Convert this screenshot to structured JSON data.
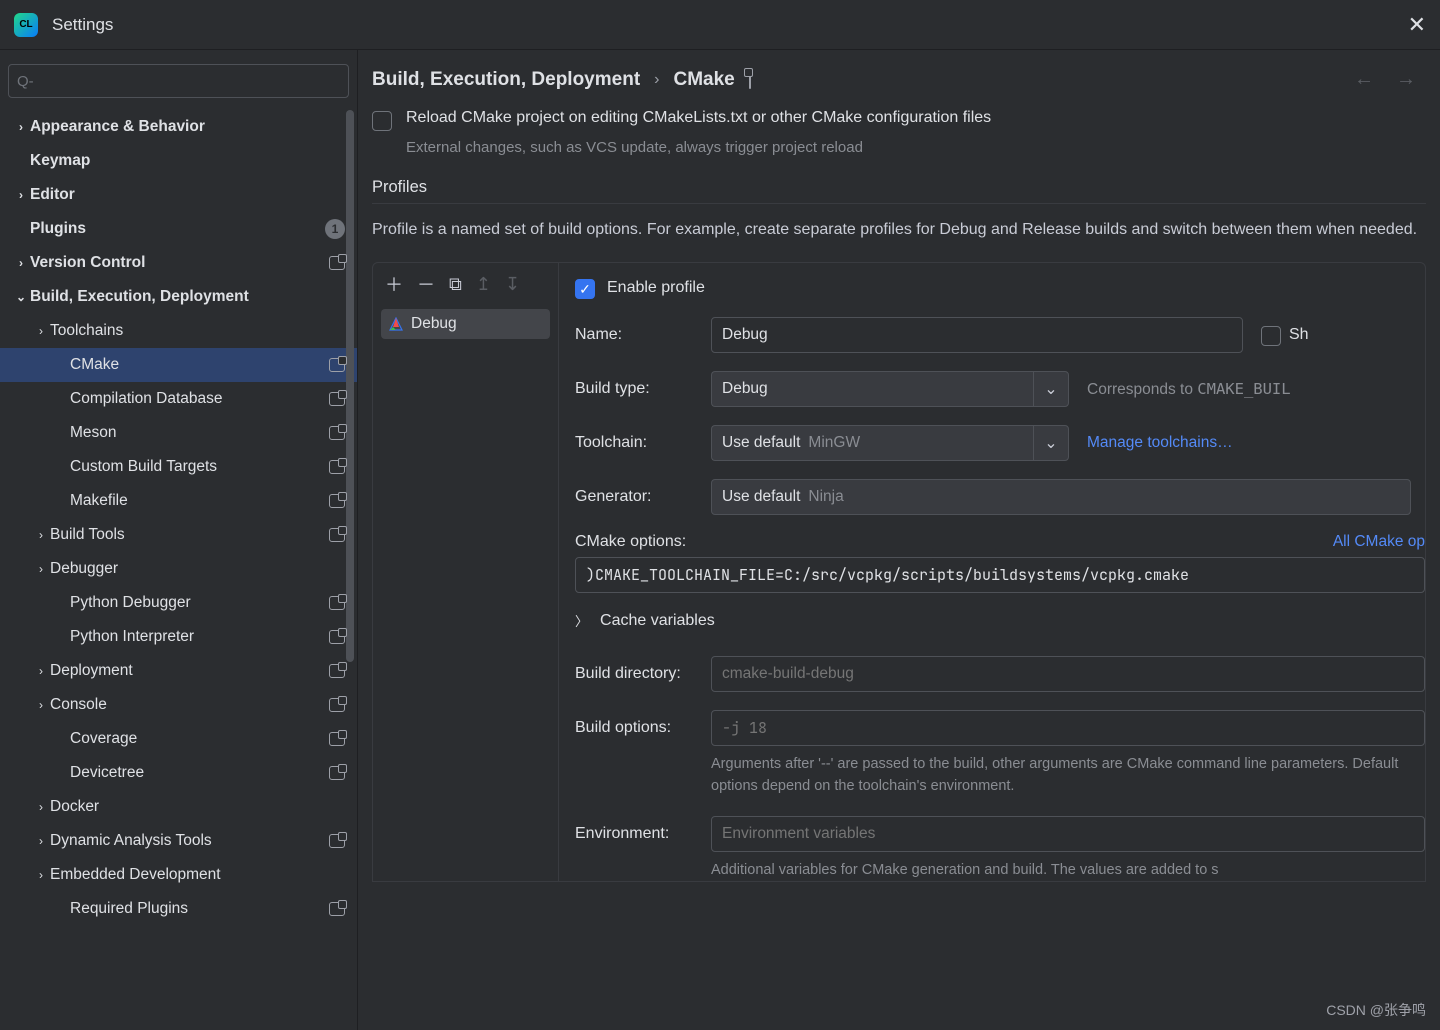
{
  "window": {
    "title": "Settings"
  },
  "breadcrumb": {
    "a": "Build, Execution, Deployment",
    "b": "CMake"
  },
  "sidebar": {
    "search_placeholder": "",
    "items": [
      {
        "label": "Appearance & Behavior",
        "bold": true,
        "chev": "right",
        "depth": 0
      },
      {
        "label": "Keymap",
        "bold": true,
        "chev": "none",
        "depth": 0
      },
      {
        "label": "Editor",
        "bold": true,
        "chev": "right",
        "depth": 0
      },
      {
        "label": "Plugins",
        "bold": true,
        "chev": "none",
        "depth": 0,
        "badge": "1"
      },
      {
        "label": "Version Control",
        "bold": true,
        "chev": "right",
        "depth": 0,
        "win": true
      },
      {
        "label": "Build, Execution, Deployment",
        "bold": true,
        "chev": "down",
        "depth": 0
      },
      {
        "label": "Toolchains",
        "chev": "right",
        "depth": 1
      },
      {
        "label": "CMake",
        "chev": "none",
        "depth": 2,
        "selected": true,
        "win": true
      },
      {
        "label": "Compilation Database",
        "chev": "none",
        "depth": 2,
        "win": true
      },
      {
        "label": "Meson",
        "chev": "none",
        "depth": 2,
        "win": true
      },
      {
        "label": "Custom Build Targets",
        "chev": "none",
        "depth": 2,
        "win": true
      },
      {
        "label": "Makefile",
        "chev": "none",
        "depth": 2,
        "win": true
      },
      {
        "label": "Build Tools",
        "chev": "right",
        "depth": 1,
        "win": true
      },
      {
        "label": "Debugger",
        "chev": "right",
        "depth": 1
      },
      {
        "label": "Python Debugger",
        "chev": "none",
        "depth": 2,
        "win": true
      },
      {
        "label": "Python Interpreter",
        "chev": "none",
        "depth": 2,
        "win": true
      },
      {
        "label": "Deployment",
        "chev": "right",
        "depth": 1,
        "win": true
      },
      {
        "label": "Console",
        "chev": "right",
        "depth": 1,
        "win": true
      },
      {
        "label": "Coverage",
        "chev": "none",
        "depth": 2,
        "win": true
      },
      {
        "label": "Devicetree",
        "chev": "none",
        "depth": 2,
        "win": true
      },
      {
        "label": "Docker",
        "chev": "right",
        "depth": 1
      },
      {
        "label": "Dynamic Analysis Tools",
        "chev": "right",
        "depth": 1,
        "win": true
      },
      {
        "label": "Embedded Development",
        "chev": "right",
        "depth": 1
      },
      {
        "label": "Required Plugins",
        "chev": "none",
        "depth": 2,
        "win": true
      }
    ]
  },
  "main": {
    "reload_label": "Reload CMake project on editing CMakeLists.txt or other CMake configuration files",
    "reload_hint": "External changes, such as VCS update, always trigger project reload",
    "profiles_header": "Profiles",
    "profiles_desc": "Profile is a named set of build options. For example, create separate profiles for Debug and Release builds and switch between them when needed.",
    "profile_list": [
      "Debug"
    ],
    "enable_label": "Enable profile",
    "fields": {
      "name_label": "Name:",
      "name_value": "Debug",
      "share_label": "Sh",
      "buildtype_label": "Build type:",
      "buildtype_value": "Debug",
      "buildtype_note_pre": "Corresponds to ",
      "buildtype_note_code": "CMAKE_BUIL",
      "toolchain_label": "Toolchain:",
      "toolchain_default": "Use default",
      "toolchain_sub": "MinGW",
      "toolchain_link": "Manage toolchains…",
      "generator_label": "Generator:",
      "generator_default": "Use default",
      "generator_sub": "Ninja",
      "cmakeopts_label": "CMake options:",
      "cmakeopts_link": "All CMake op",
      "cmakeopts_value": ")CMAKE_TOOLCHAIN_FILE=C:/src/vcpkg/scripts/buildsystems/vcpkg.cmake",
      "cache_label": "Cache variables",
      "builddir_label": "Build directory:",
      "builddir_placeholder": "cmake-build-debug",
      "buildopts_label": "Build options:",
      "buildopts_placeholder": "-j 18",
      "buildopts_note": "Arguments after '--' are passed to the build, other arguments are CMake command line parameters. Default options depend on the toolchain's environment.",
      "env_label": "Environment:",
      "env_placeholder": "Environment variables",
      "env_note": "Additional variables for CMake generation and build. The values are added to s"
    }
  },
  "watermark": "CSDN @张争鸣"
}
